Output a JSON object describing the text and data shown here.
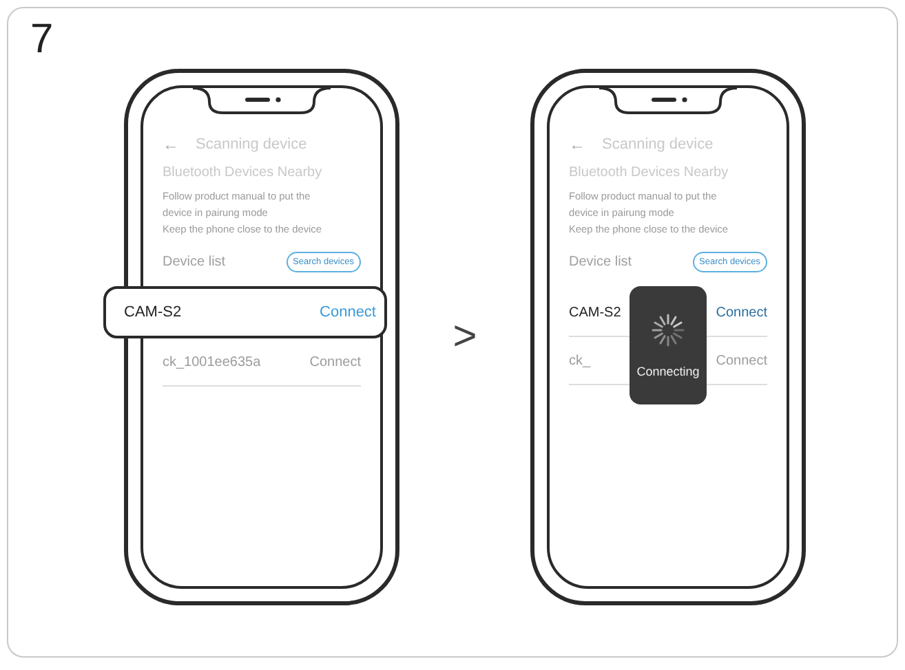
{
  "step": "7",
  "arrow": ">",
  "phones": [
    {
      "back": "←",
      "title": "Scanning device",
      "section_title": "Bluetooth Devices Nearby",
      "instructions": [
        "Follow product manual to put the",
        "device in pairung mode",
        "Keep the phone close to the device"
      ],
      "list_label": "Device list",
      "search_button": "Search devices",
      "devices": [
        {
          "name": "CAM-S2",
          "action": "Connect",
          "kind": "callout"
        },
        {
          "name": "ck_1001ee635a",
          "action": "Connect",
          "kind": "faded"
        }
      ]
    },
    {
      "back": "←",
      "title": "Scanning device",
      "section_title": "Bluetooth Devices Nearby",
      "instructions": [
        "Follow product manual to put the",
        "device in pairung mode",
        "Keep the phone close to the device"
      ],
      "list_label": "Device list",
      "search_button": "Search devices",
      "devices": [
        {
          "name": "CAM-S2",
          "action": "Connect",
          "kind": "active"
        },
        {
          "name": "ck_",
          "action": "Connect",
          "kind": "faded"
        }
      ],
      "toast": {
        "text": "Connecting"
      }
    }
  ]
}
